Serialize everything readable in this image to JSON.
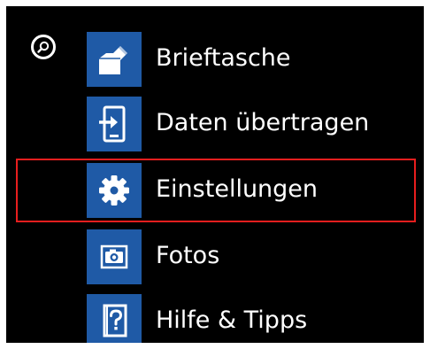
{
  "search": {
    "icon": "search-icon"
  },
  "apps": [
    {
      "label": "Brieftasche",
      "icon": "wallet-icon",
      "tile_color": "#1f5aa6"
    },
    {
      "label": "Daten übertragen",
      "icon": "data-transfer-icon",
      "tile_color": "#1f5aa6"
    },
    {
      "label": "Einstellungen",
      "icon": "gear-icon",
      "tile_color": "#1f5aa6",
      "highlighted": true
    },
    {
      "label": "Fotos",
      "icon": "camera-icon",
      "tile_color": "#1f5aa6"
    },
    {
      "label": "Hilfe & Tipps",
      "icon": "help-icon",
      "tile_color": "#1f5aa6"
    }
  ],
  "colors": {
    "background": "#000000",
    "tile": "#1f5aa6",
    "text": "#ffffff",
    "highlight": "#e81e1e"
  }
}
